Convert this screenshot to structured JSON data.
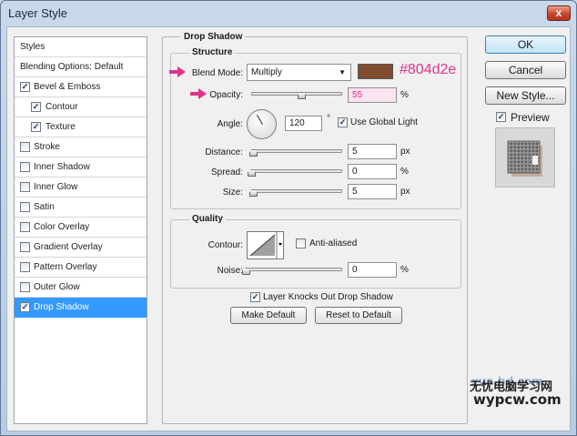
{
  "window": {
    "title": "Layer Style",
    "close_label": "x"
  },
  "styles_list": {
    "header": "Styles",
    "items": [
      {
        "label": "Blending Options: Default",
        "has_checkbox": false,
        "checked": false,
        "indent": false,
        "selected": false
      },
      {
        "label": "Bevel & Emboss",
        "has_checkbox": true,
        "checked": true,
        "indent": false,
        "selected": false
      },
      {
        "label": "Contour",
        "has_checkbox": true,
        "checked": true,
        "indent": true,
        "selected": false
      },
      {
        "label": "Texture",
        "has_checkbox": true,
        "checked": true,
        "indent": true,
        "selected": false
      },
      {
        "label": "Stroke",
        "has_checkbox": true,
        "checked": false,
        "indent": false,
        "selected": false
      },
      {
        "label": "Inner Shadow",
        "has_checkbox": true,
        "checked": false,
        "indent": false,
        "selected": false
      },
      {
        "label": "Inner Glow",
        "has_checkbox": true,
        "checked": false,
        "indent": false,
        "selected": false
      },
      {
        "label": "Satin",
        "has_checkbox": true,
        "checked": false,
        "indent": false,
        "selected": false
      },
      {
        "label": "Color Overlay",
        "has_checkbox": true,
        "checked": false,
        "indent": false,
        "selected": false
      },
      {
        "label": "Gradient Overlay",
        "has_checkbox": true,
        "checked": false,
        "indent": false,
        "selected": false
      },
      {
        "label": "Pattern Overlay",
        "has_checkbox": true,
        "checked": false,
        "indent": false,
        "selected": false
      },
      {
        "label": "Outer Glow",
        "has_checkbox": true,
        "checked": false,
        "indent": false,
        "selected": false
      },
      {
        "label": "Drop Shadow",
        "has_checkbox": true,
        "checked": true,
        "indent": false,
        "selected": true
      }
    ]
  },
  "drop_shadow": {
    "title": "Drop Shadow",
    "structure": {
      "title": "Structure",
      "blend_mode_label": "Blend Mode:",
      "blend_mode_value": "Multiply",
      "shadow_color": "#804d2e",
      "color_annotation": "#804d2e",
      "opacity_label": "Opacity:",
      "opacity_value": "55",
      "opacity_unit": "%",
      "opacity_slider_value": 0.55,
      "angle_label": "Angle:",
      "angle_value": "120",
      "angle_unit": "°",
      "use_global_light_label": "Use Global Light",
      "use_global_light_checked": true,
      "distance_label": "Distance:",
      "distance_value": "5",
      "distance_unit": "px",
      "distance_slider_value": 0.02,
      "spread_label": "Spread:",
      "spread_value": "0",
      "spread_unit": "%",
      "spread_slider_value": 0.0,
      "size_label": "Size:",
      "size_value": "5",
      "size_unit": "px",
      "size_slider_value": 0.02
    },
    "quality": {
      "title": "Quality",
      "contour_label": "Contour:",
      "anti_aliased_label": "Anti-aliased",
      "anti_aliased_checked": false,
      "noise_label": "Noise:",
      "noise_value": "0",
      "noise_unit": "%",
      "noise_slider_value": 0.0
    },
    "knocks_out_label": "Layer Knocks Out Drop Shadow",
    "knocks_out_checked": true,
    "make_default_label": "Make Default",
    "reset_default_label": "Reset to Default"
  },
  "buttons": {
    "ok_label": "OK",
    "cancel_label": "Cancel",
    "new_style_label": "New Style...",
    "preview_label": "Preview",
    "preview_checked": true
  },
  "colors": {
    "selection": "#3399ff",
    "annotation_arrow": "#e0338c"
  },
  "watermark": {
    "line1": "无忧电脑学习网",
    "line2": "wypcw.com",
    "faint": "xue.hd.com"
  }
}
